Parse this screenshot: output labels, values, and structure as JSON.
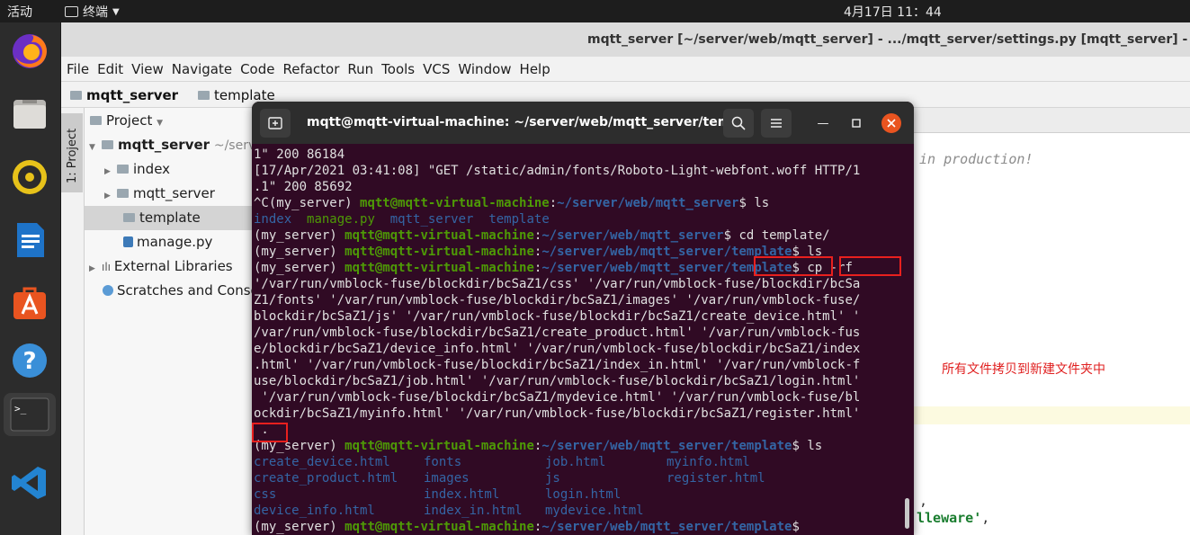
{
  "topbar": {
    "activities": "活动",
    "app_menu": "终端",
    "clock": "4月17日  11：44"
  },
  "dock": {
    "items": [
      "firefox-icon",
      "files-icon",
      "rhythmbox-icon",
      "writer-icon",
      "software-icon",
      "help-icon",
      "terminal-icon",
      "vscode-icon"
    ]
  },
  "pycharm": {
    "title": "mqtt_server [~/server/web/mqtt_server] - .../mqtt_server/settings.py [mqtt_server] - PyCharm",
    "menu": [
      "File",
      "Edit",
      "View",
      "Navigate",
      "Code",
      "Refactor",
      "Run",
      "Tools",
      "VCS",
      "Window",
      "Help"
    ],
    "breadcrumb": {
      "root": "mqtt_server",
      "child": "template"
    },
    "side_tab": "1: Project",
    "project": {
      "header": "Project",
      "root_name": "mqtt_server",
      "root_path": "~/server",
      "items": [
        "index",
        "mqtt_server",
        "template",
        "manage.py"
      ],
      "external": "External Libraries",
      "scratches": "Scratches and Consoles"
    },
    "editor": {
      "comment": "in production!",
      "annotation": "所有文件拷贝到新建文件夹中",
      "comma": ",",
      "middleware_fragment": "lleware'",
      "middleware_tail": ","
    }
  },
  "terminal": {
    "title": "mqtt@mqtt-virtual-machine: ~/server/web/mqtt_server/tem...",
    "env": "(my_server) ",
    "user": "mqtt@mqtt-virtual-machine",
    "path_root": "~/server/web/mqtt_server",
    "path_tpl": "~/server/web/mqtt_server/template",
    "lines": {
      "l0": "1\" 200 86184",
      "l1": "[17/Apr/2021 03:41:08] \"GET /static/admin/fonts/Roboto-Light-webfont.woff HTTP/1",
      "l2": ".1\" 200 85692",
      "l3_pre": "^C(my_server) ",
      "ls_cmd": "$ ls",
      "ls1": [
        "index",
        "manage.py",
        "mqtt_server",
        "template"
      ],
      "cd_cmd": "$ cd template/",
      "cp_cmd": "$ cp -rf",
      "cp_args": [
        "'/var/run/vmblock-fuse/blockdir/bcSaZ1/css' '/var/run/vmblock-fuse/blockdir/bcSa",
        "Z1/fonts' '/var/run/vmblock-fuse/blockdir/bcSaZ1/images' '/var/run/vmblock-fuse/",
        "blockdir/bcSaZ1/js' '/var/run/vmblock-fuse/blockdir/bcSaZ1/create_device.html' '",
        "/var/run/vmblock-fuse/blockdir/bcSaZ1/create_product.html' '/var/run/vmblock-fus",
        "e/blockdir/bcSaZ1/device_info.html' '/var/run/vmblock-fuse/blockdir/bcSaZ1/index",
        ".html' '/var/run/vmblock-fuse/blockdir/bcSaZ1/index_in.html' '/var/run/vmblock-f",
        "use/blockdir/bcSaZ1/job.html' '/var/run/vmblock-fuse/blockdir/bcSaZ1/login.html'",
        " '/var/run/vmblock-fuse/blockdir/bcSaZ1/mydevice.html' '/var/run/vmblock-fuse/bl",
        "ockdir/bcSaZ1/myinfo.html' '/var/run/vmblock-fuse/blockdir/bcSaZ1/register.html'",
        " ."
      ],
      "ls2": [
        [
          "create_device.html",
          "fonts",
          "job.html",
          "myinfo.html"
        ],
        [
          "create_product.html",
          "images",
          "js",
          "register.html"
        ],
        [
          "css",
          "index.html",
          "login.html",
          ""
        ],
        [
          "device_info.html",
          "index_in.html",
          "mydevice.html",
          ""
        ]
      ],
      "final_prompt_end": "$"
    }
  }
}
